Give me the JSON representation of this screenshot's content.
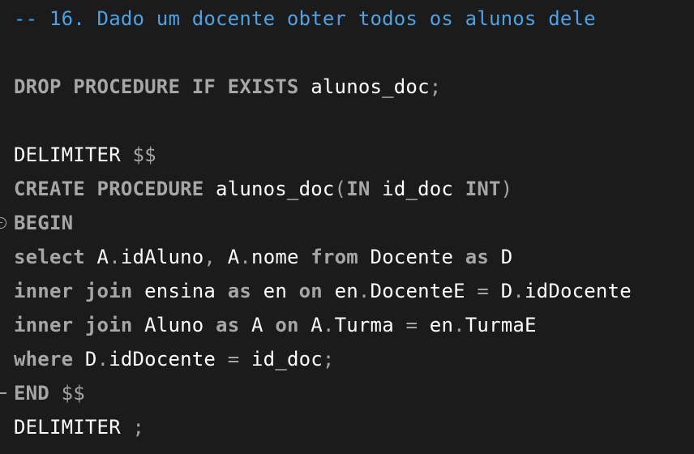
{
  "editor": {
    "lines": [
      {
        "tokens": [
          {
            "t": "-- 16. Dado um docente obter todos os alunos dele",
            "k": "comment"
          }
        ]
      },
      {
        "tokens": []
      },
      {
        "tokens": [
          {
            "t": "DROP PROCEDURE IF EXISTS",
            "k": "keyword"
          },
          {
            "t": " alunos_doc",
            "k": "ident"
          },
          {
            "t": ";",
            "k": "punct"
          }
        ]
      },
      {
        "tokens": []
      },
      {
        "tokens": [
          {
            "t": "DELIMITER",
            "k": "ident"
          },
          {
            "t": " $$",
            "k": "punct"
          }
        ]
      },
      {
        "tokens": [
          {
            "t": "CREATE PROCEDURE",
            "k": "keyword"
          },
          {
            "t": " alunos_doc",
            "k": "ident"
          },
          {
            "t": "(",
            "k": "punct"
          },
          {
            "t": "IN",
            "k": "keyword"
          },
          {
            "t": " id_doc ",
            "k": "ident"
          },
          {
            "t": "INT",
            "k": "keyword"
          },
          {
            "t": ")",
            "k": "punct"
          }
        ]
      },
      {
        "tokens": [
          {
            "t": "BEGIN",
            "k": "keyword"
          }
        ],
        "fold": "start"
      },
      {
        "tokens": [
          {
            "t": "select",
            "k": "keyword"
          },
          {
            "t": " A",
            "k": "ident"
          },
          {
            "t": ".",
            "k": "punct"
          },
          {
            "t": "idAluno",
            "k": "ident"
          },
          {
            "t": ", ",
            "k": "punct"
          },
          {
            "t": "A",
            "k": "ident"
          },
          {
            "t": ".",
            "k": "punct"
          },
          {
            "t": "nome ",
            "k": "ident"
          },
          {
            "t": "from",
            "k": "keyword"
          },
          {
            "t": " Docente ",
            "k": "ident"
          },
          {
            "t": "as",
            "k": "keyword"
          },
          {
            "t": " D",
            "k": "ident"
          }
        ]
      },
      {
        "tokens": [
          {
            "t": "inner join",
            "k": "keyword"
          },
          {
            "t": " ensina ",
            "k": "ident"
          },
          {
            "t": "as",
            "k": "keyword"
          },
          {
            "t": " en ",
            "k": "ident"
          },
          {
            "t": "on",
            "k": "keyword"
          },
          {
            "t": " en",
            "k": "ident"
          },
          {
            "t": ".",
            "k": "punct"
          },
          {
            "t": "DocenteE ",
            "k": "ident"
          },
          {
            "t": "=",
            "k": "punct"
          },
          {
            "t": " D",
            "k": "ident"
          },
          {
            "t": ".",
            "k": "punct"
          },
          {
            "t": "idDocente",
            "k": "ident"
          }
        ]
      },
      {
        "tokens": [
          {
            "t": "inner join",
            "k": "keyword"
          },
          {
            "t": " Aluno ",
            "k": "ident"
          },
          {
            "t": "as",
            "k": "keyword"
          },
          {
            "t": " A ",
            "k": "ident"
          },
          {
            "t": "on",
            "k": "keyword"
          },
          {
            "t": " A",
            "k": "ident"
          },
          {
            "t": ".",
            "k": "punct"
          },
          {
            "t": "Turma ",
            "k": "ident"
          },
          {
            "t": "=",
            "k": "punct"
          },
          {
            "t": " en",
            "k": "ident"
          },
          {
            "t": ".",
            "k": "punct"
          },
          {
            "t": "TurmaE",
            "k": "ident"
          }
        ]
      },
      {
        "tokens": [
          {
            "t": "where",
            "k": "keyword"
          },
          {
            "t": " D",
            "k": "ident"
          },
          {
            "t": ".",
            "k": "punct"
          },
          {
            "t": "idDocente ",
            "k": "ident"
          },
          {
            "t": "=",
            "k": "punct"
          },
          {
            "t": " id_doc",
            "k": "ident"
          },
          {
            "t": ";",
            "k": "punct"
          }
        ]
      },
      {
        "tokens": [
          {
            "t": "END",
            "k": "keyword"
          },
          {
            "t": " $$",
            "k": "punct"
          }
        ],
        "fold": "end"
      },
      {
        "tokens": [
          {
            "t": "DELIMITER",
            "k": "ident"
          },
          {
            "t": " ;",
            "k": "punct"
          }
        ]
      }
    ]
  },
  "colors": {
    "background": "#1b1b1b",
    "comment": "#4aa3e6",
    "keyword": "#a6a6a6",
    "identifier": "#ffffff"
  },
  "icons": {
    "fold_start": "fold-collapse-icon",
    "fold_end": "fold-end-marker-icon"
  }
}
